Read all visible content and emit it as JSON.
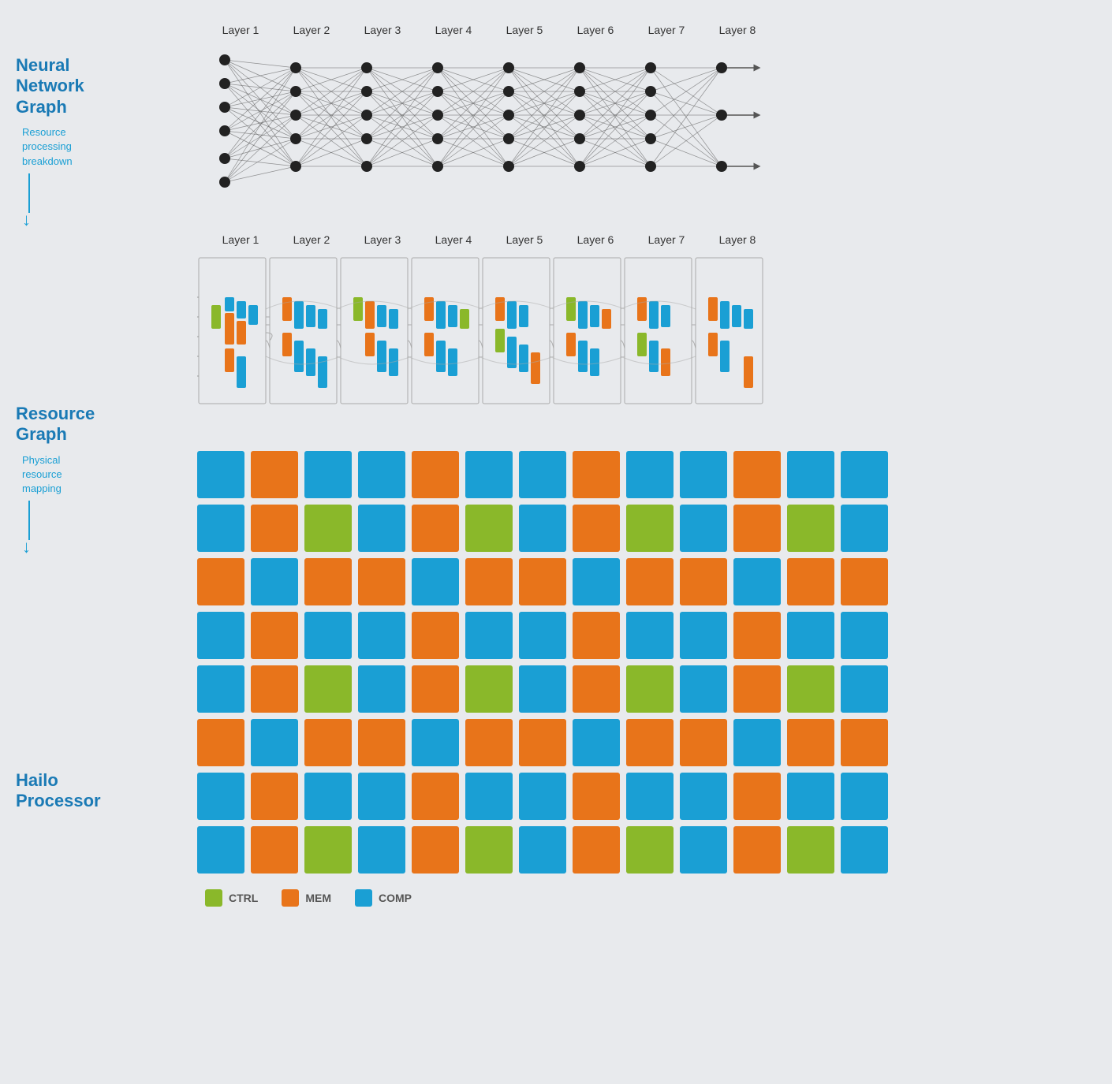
{
  "sections": [
    {
      "id": "neural-network",
      "title": "Neural\nNetwork\nGraph",
      "sublabel": "Resource\nprocessing\nbreakdown"
    },
    {
      "id": "resource-graph",
      "title": "Resource\nGraph",
      "sublabel": "Physical\nresource\nmapping"
    },
    {
      "id": "hailo-processor",
      "title": "Hailo\nProcessor",
      "sublabel": ""
    }
  ],
  "layers": [
    "Layer 1",
    "Layer 2",
    "Layer 3",
    "Layer 4",
    "Layer 5",
    "Layer 6",
    "Layer 7",
    "Layer 8"
  ],
  "legend": [
    {
      "id": "ctrl",
      "label": "CTRL",
      "color": "#8ab82a"
    },
    {
      "id": "mem",
      "label": "MEM",
      "color": "#e8741a"
    },
    {
      "id": "comp",
      "label": "COMP",
      "color": "#1a9fd4"
    }
  ],
  "processor_grid": [
    [
      "blue",
      "orange",
      "blue",
      "blue",
      "orange",
      "blue",
      "blue",
      "orange",
      "blue",
      "blue",
      "orange",
      "blue",
      "blue"
    ],
    [
      "blue",
      "orange",
      "green",
      "blue",
      "orange",
      "green",
      "blue",
      "orange",
      "green",
      "blue",
      "orange",
      "green",
      "blue"
    ],
    [
      "orange",
      "blue",
      "orange",
      "orange",
      "blue",
      "orange",
      "orange",
      "blue",
      "orange",
      "orange",
      "blue",
      "orange",
      "orange"
    ],
    [
      "blue",
      "orange",
      "blue",
      "blue",
      "orange",
      "blue",
      "blue",
      "orange",
      "blue",
      "blue",
      "orange",
      "blue",
      "blue"
    ],
    [
      "blue",
      "orange",
      "green",
      "blue",
      "orange",
      "green",
      "blue",
      "orange",
      "green",
      "blue",
      "orange",
      "green",
      "blue"
    ],
    [
      "orange",
      "blue",
      "orange",
      "orange",
      "blue",
      "orange",
      "orange",
      "blue",
      "orange",
      "orange",
      "blue",
      "orange",
      "orange"
    ],
    [
      "blue",
      "orange",
      "blue",
      "blue",
      "orange",
      "blue",
      "blue",
      "orange",
      "blue",
      "blue",
      "orange",
      "blue",
      "blue"
    ],
    [
      "blue",
      "orange",
      "green",
      "blue",
      "orange",
      "green",
      "blue",
      "orange",
      "green",
      "blue",
      "orange",
      "green",
      "blue"
    ]
  ]
}
